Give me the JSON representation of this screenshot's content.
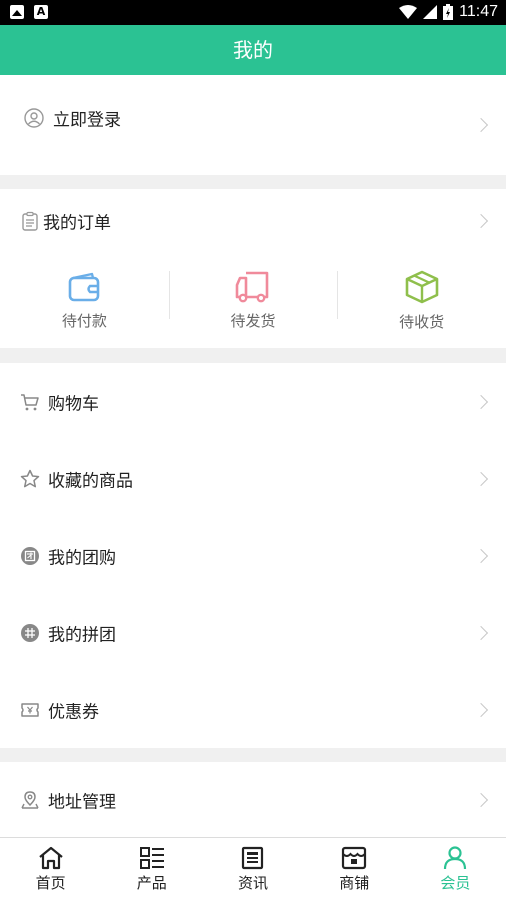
{
  "status_bar": {
    "time": "11:47"
  },
  "header": {
    "title": "我的"
  },
  "login": {
    "label": "立即登录"
  },
  "orders": {
    "title": "我的订单",
    "items": [
      {
        "label": "待付款",
        "icon": "wallet-icon",
        "color": "#6aaee8"
      },
      {
        "label": "待发货",
        "icon": "truck-icon",
        "color": "#f08a9b"
      },
      {
        "label": "待收货",
        "icon": "box-icon",
        "color": "#8fbf4c"
      }
    ]
  },
  "menu": [
    {
      "label": "购物车",
      "icon": "cart-icon"
    },
    {
      "label": "收藏的商品",
      "icon": "star-icon"
    },
    {
      "label": "我的团购",
      "icon": "group-buy-icon"
    },
    {
      "label": "我的拼团",
      "icon": "team-buy-icon"
    },
    {
      "label": "优惠券",
      "icon": "coupon-icon"
    }
  ],
  "address": {
    "label": "地址管理",
    "icon": "location-icon"
  },
  "tabbar": {
    "items": [
      {
        "label": "首页",
        "icon": "home-icon"
      },
      {
        "label": "产品",
        "icon": "list-icon"
      },
      {
        "label": "资讯",
        "icon": "news-icon"
      },
      {
        "label": "商铺",
        "icon": "shop-icon"
      },
      {
        "label": "会员",
        "icon": "member-icon"
      }
    ],
    "active_color": "#2bc293"
  },
  "theme": {
    "primary": "#2bc293"
  }
}
